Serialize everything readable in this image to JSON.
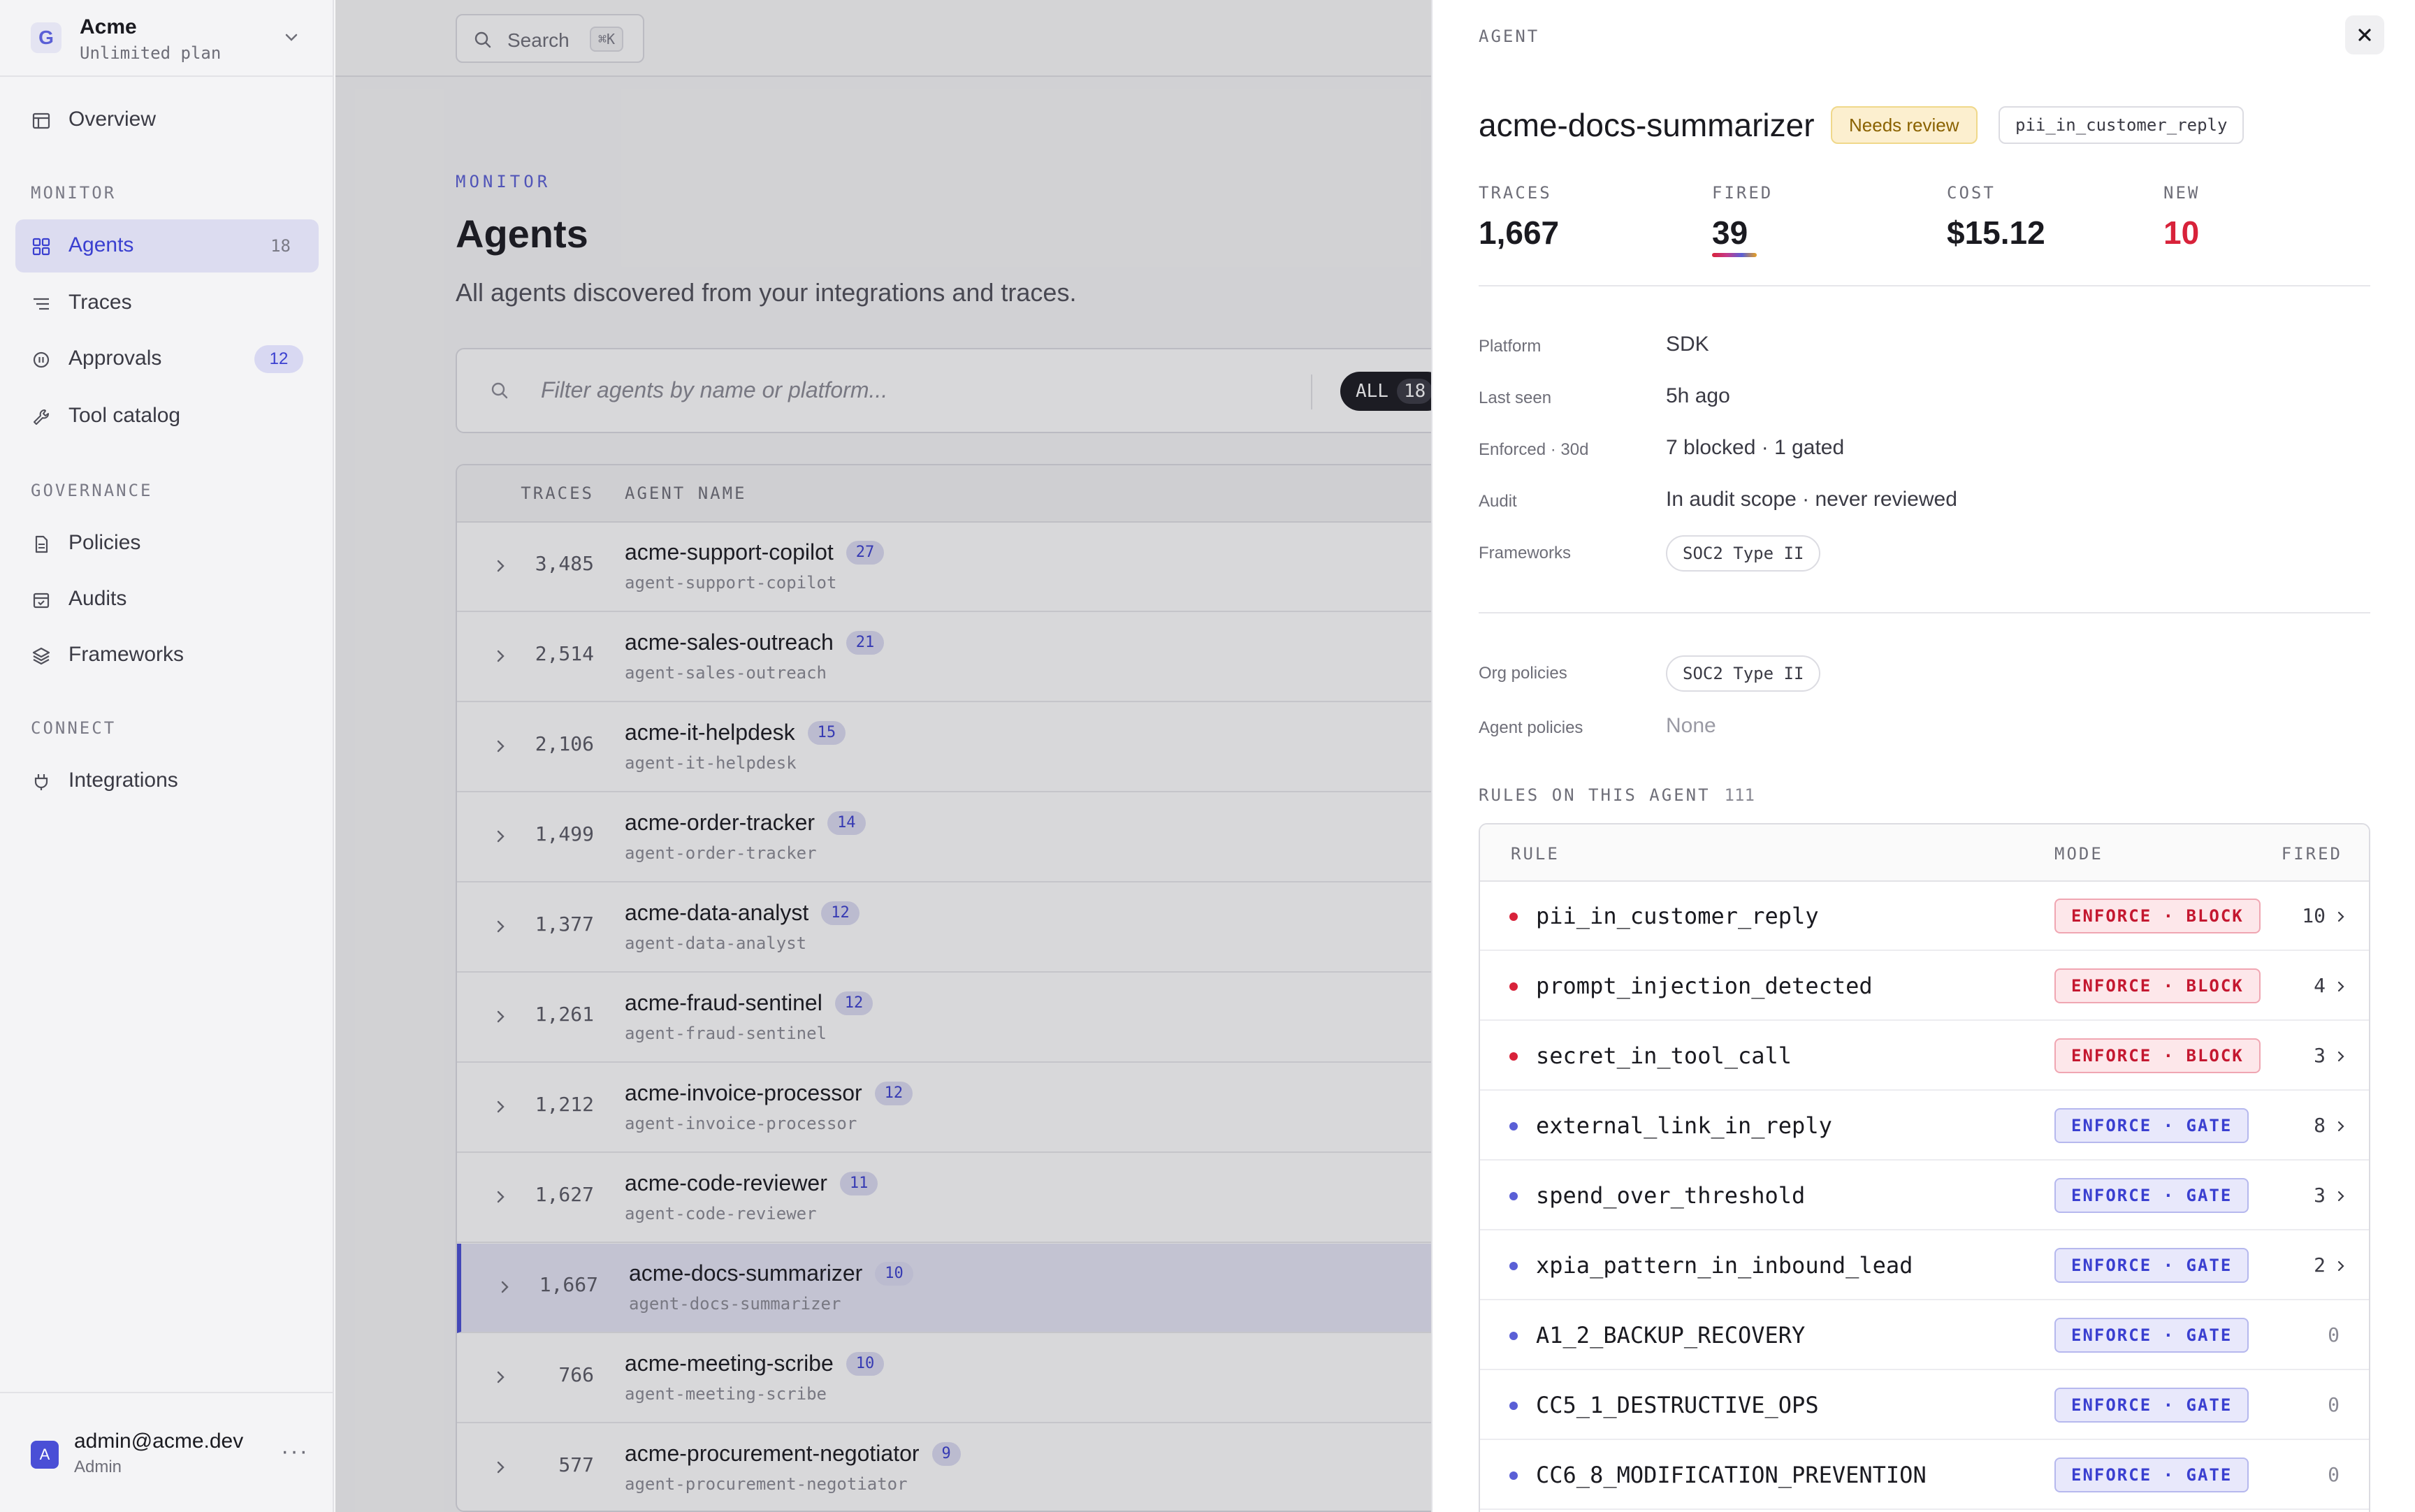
{
  "org": {
    "name": "Acme",
    "plan": "Unlimited plan"
  },
  "nav": {
    "overview": "Overview",
    "monitor_section": "MONITOR",
    "agents": {
      "label": "Agents",
      "count": "18"
    },
    "traces": "Traces",
    "approvals": {
      "label": "Approvals",
      "badge": "12"
    },
    "tool_catalog": "Tool catalog",
    "governance_section": "GOVERNANCE",
    "policies": "Policies",
    "audits": "Audits",
    "frameworks": "Frameworks",
    "connect_section": "CONNECT",
    "integrations": "Integrations"
  },
  "user": {
    "avatar": "A",
    "email": "admin@acme.dev",
    "role": "Admin",
    "more": "···"
  },
  "topbar": {
    "search_label": "Search",
    "search_shortcut": "⌘K"
  },
  "page": {
    "eyebrow": "MONITOR",
    "title": "Agents",
    "subtitle": "All agents discovered from your integrations and traces.",
    "filter_placeholder": "Filter agents by name or platform...",
    "chip_all_label": "ALL",
    "chip_all_count": "18"
  },
  "table": {
    "col_traces": "TRACES",
    "col_agent_name": "AGENT NAME",
    "rows": [
      {
        "traces": "3,485",
        "name": "acme-support-copilot",
        "id": "agent-support-copilot",
        "count": "27"
      },
      {
        "traces": "2,514",
        "name": "acme-sales-outreach",
        "id": "agent-sales-outreach",
        "count": "21"
      },
      {
        "traces": "2,106",
        "name": "acme-it-helpdesk",
        "id": "agent-it-helpdesk",
        "count": "15"
      },
      {
        "traces": "1,499",
        "name": "acme-order-tracker",
        "id": "agent-order-tracker",
        "count": "14"
      },
      {
        "traces": "1,377",
        "name": "acme-data-analyst",
        "id": "agent-data-analyst",
        "count": "12"
      },
      {
        "traces": "1,261",
        "name": "acme-fraud-sentinel",
        "id": "agent-fraud-sentinel",
        "count": "12"
      },
      {
        "traces": "1,212",
        "name": "acme-invoice-processor",
        "id": "agent-invoice-processor",
        "count": "12"
      },
      {
        "traces": "1,627",
        "name": "acme-code-reviewer",
        "id": "agent-code-reviewer",
        "count": "11"
      },
      {
        "traces": "1,667",
        "name": "acme-docs-summarizer",
        "id": "agent-docs-summarizer",
        "count": "10"
      },
      {
        "traces": "766",
        "name": "acme-meeting-scribe",
        "id": "agent-meeting-scribe",
        "count": "10"
      },
      {
        "traces": "577",
        "name": "acme-procurement-negotiator",
        "id": "agent-procurement-negotiator",
        "count": "9"
      }
    ]
  },
  "drawer": {
    "kicker": "AGENT",
    "close_icon": "close-icon",
    "title": "acme-docs-summarizer",
    "review_badge": "Needs review",
    "rule_chip": "pii_in_customer_reply",
    "stats": {
      "traces_label": "TRACES",
      "traces": "1,667",
      "fired_label": "FIRED",
      "fired": "39",
      "cost_label": "COST",
      "cost": "$15.12",
      "new_label": "NEW",
      "new": "10"
    },
    "props": {
      "platform_label": "Platform",
      "platform": "SDK",
      "last_seen_label": "Last seen",
      "last_seen": "5h ago",
      "enforced_label": "Enforced · 30d",
      "enforced": "7 blocked · 1 gated",
      "audit_label": "Audit",
      "audit": "In audit scope · never reviewed",
      "frameworks_label": "Frameworks",
      "framework": "SOC2 Type II",
      "org_policies_label": "Org policies",
      "org_policy": "SOC2 Type II",
      "agent_policies_label": "Agent policies",
      "agent_policies": "None"
    },
    "rules_heading": "RULES ON THIS AGENT",
    "rules_count": "111",
    "rules_cols": {
      "rule": "RULE",
      "mode": "MODE",
      "fired": "FIRED"
    },
    "rules": [
      {
        "name": "pii_in_customer_reply",
        "mode": "ENFORCE · BLOCK",
        "fired": "10"
      },
      {
        "name": "prompt_injection_detected",
        "mode": "ENFORCE · BLOCK",
        "fired": "4"
      },
      {
        "name": "secret_in_tool_call",
        "mode": "ENFORCE · BLOCK",
        "fired": "3"
      },
      {
        "name": "external_link_in_reply",
        "mode": "ENFORCE · GATE",
        "fired": "8"
      },
      {
        "name": "spend_over_threshold",
        "mode": "ENFORCE · GATE",
        "fired": "3"
      },
      {
        "name": "xpia_pattern_in_inbound_lead",
        "mode": "ENFORCE · GATE",
        "fired": "2"
      },
      {
        "name": "A1_2_BACKUP_RECOVERY",
        "mode": "ENFORCE · GATE",
        "fired": "0"
      },
      {
        "name": "CC5_1_DESTRUCTIVE_OPS",
        "mode": "ENFORCE · GATE",
        "fired": "0"
      },
      {
        "name": "CC6_8_MODIFICATION_PREVENTION",
        "mode": "ENFORCE · GATE",
        "fired": "0"
      }
    ]
  },
  "colors": {
    "accent": "#4a4fd6",
    "block_red": "#d8223a",
    "gate_blue": "#5a5fd6",
    "warn": "#fcefcf"
  }
}
